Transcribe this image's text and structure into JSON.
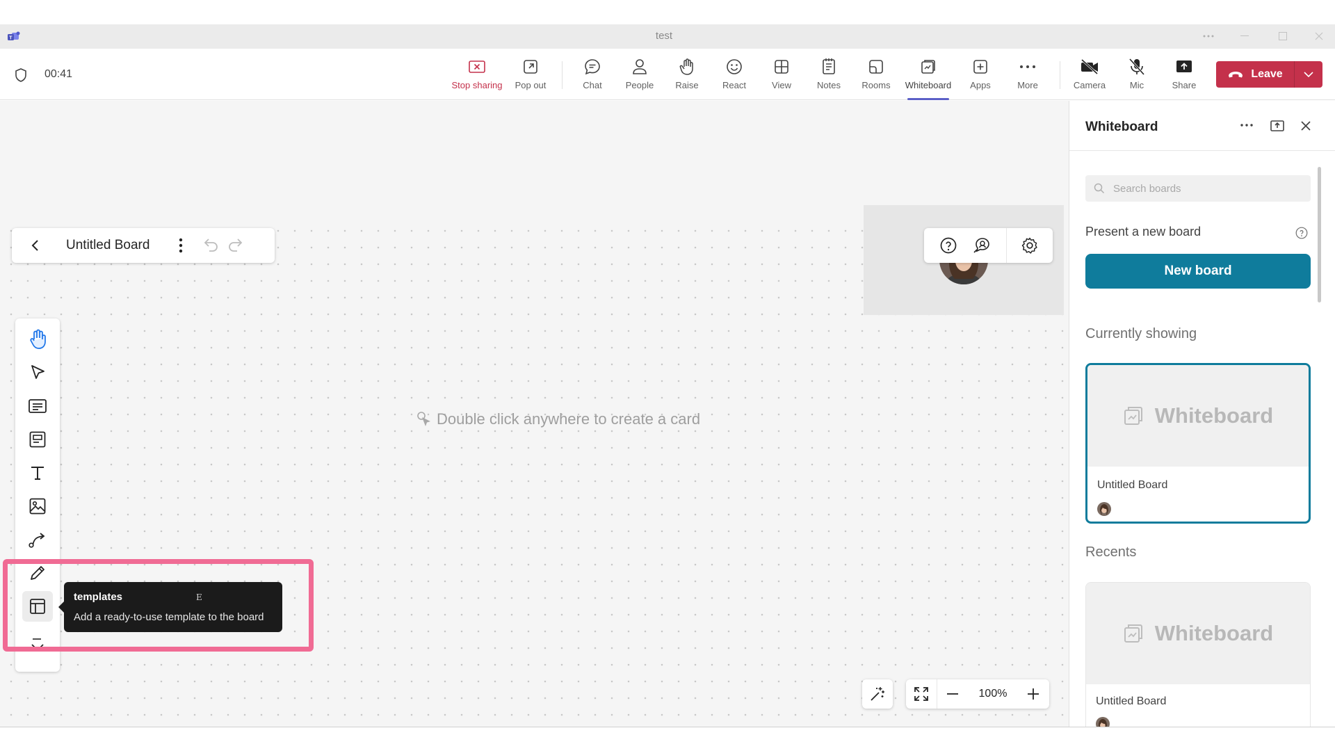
{
  "window": {
    "title": "test"
  },
  "meeting": {
    "timer": "00:41",
    "toolbar": [
      {
        "key": "stop-sharing",
        "label": "Stop sharing",
        "icon": "stop-sharing-icon"
      },
      {
        "key": "pop-out",
        "label": "Pop out",
        "icon": "pop-out-icon"
      },
      {
        "key": "chat",
        "label": "Chat",
        "icon": "chat-icon"
      },
      {
        "key": "people",
        "label": "People",
        "icon": "people-icon"
      },
      {
        "key": "raise",
        "label": "Raise",
        "icon": "raise-hand-icon"
      },
      {
        "key": "react",
        "label": "React",
        "icon": "react-icon"
      },
      {
        "key": "view",
        "label": "View",
        "icon": "view-icon"
      },
      {
        "key": "notes",
        "label": "Notes",
        "icon": "notes-icon"
      },
      {
        "key": "rooms",
        "label": "Rooms",
        "icon": "rooms-icon"
      },
      {
        "key": "whiteboard",
        "label": "Whiteboard",
        "icon": "whiteboard-icon"
      },
      {
        "key": "apps",
        "label": "Apps",
        "icon": "apps-icon"
      },
      {
        "key": "more",
        "label": "More",
        "icon": "more-icon"
      },
      {
        "key": "camera",
        "label": "Camera",
        "icon": "camera-off-icon"
      },
      {
        "key": "mic",
        "label": "Mic",
        "icon": "mic-off-icon"
      },
      {
        "key": "share",
        "label": "Share",
        "icon": "share-icon"
      }
    ],
    "active_tab": "Whiteboard",
    "leave_label": "Leave"
  },
  "board": {
    "title": "Untitled Board",
    "hint": "Double click anywhere to create a card",
    "tooltip": {
      "title": "templates",
      "shortcut": "E",
      "description": "Add a ready-to-use template to the board"
    },
    "zoom": "100%",
    "tools": [
      "hand-icon",
      "select-pointer-icon",
      "note-card-icon",
      "card-icon",
      "text-icon",
      "image-icon",
      "connector-icon",
      "pen-icon",
      "templates-icon",
      "more-tools-icon"
    ]
  },
  "panel": {
    "title": "Whiteboard",
    "search_placeholder": "Search boards",
    "present_label": "Present a new board",
    "new_board_label": "New board",
    "currently_showing_label": "Currently showing",
    "current_board": {
      "thumb_label": "Whiteboard",
      "name": "Untitled Board"
    },
    "recents_label": "Recents",
    "recent_boards": [
      {
        "thumb_label": "Whiteboard",
        "name": "Untitled Board"
      }
    ]
  },
  "colors": {
    "accent": "#5b5fc7",
    "leave": "#c4314b",
    "primary_button": "#0f7c9c",
    "highlight": "#f06b94"
  }
}
